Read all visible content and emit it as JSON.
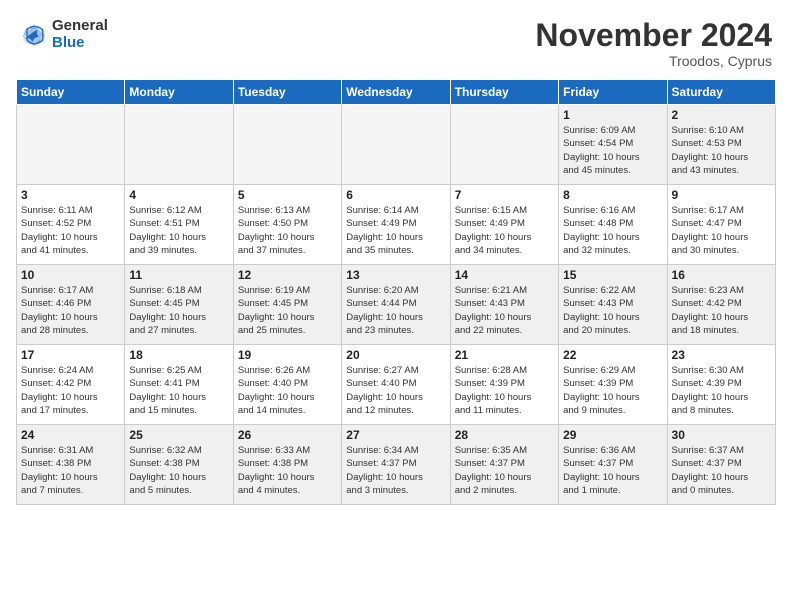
{
  "header": {
    "logo_general": "General",
    "logo_blue": "Blue",
    "month": "November 2024",
    "location": "Troodos, Cyprus"
  },
  "weekdays": [
    "Sunday",
    "Monday",
    "Tuesday",
    "Wednesday",
    "Thursday",
    "Friday",
    "Saturday"
  ],
  "weeks": [
    [
      {
        "day": "",
        "info": ""
      },
      {
        "day": "",
        "info": ""
      },
      {
        "day": "",
        "info": ""
      },
      {
        "day": "",
        "info": ""
      },
      {
        "day": "",
        "info": ""
      },
      {
        "day": "1",
        "info": "Sunrise: 6:09 AM\nSunset: 4:54 PM\nDaylight: 10 hours\nand 45 minutes."
      },
      {
        "day": "2",
        "info": "Sunrise: 6:10 AM\nSunset: 4:53 PM\nDaylight: 10 hours\nand 43 minutes."
      }
    ],
    [
      {
        "day": "3",
        "info": "Sunrise: 6:11 AM\nSunset: 4:52 PM\nDaylight: 10 hours\nand 41 minutes."
      },
      {
        "day": "4",
        "info": "Sunrise: 6:12 AM\nSunset: 4:51 PM\nDaylight: 10 hours\nand 39 minutes."
      },
      {
        "day": "5",
        "info": "Sunrise: 6:13 AM\nSunset: 4:50 PM\nDaylight: 10 hours\nand 37 minutes."
      },
      {
        "day": "6",
        "info": "Sunrise: 6:14 AM\nSunset: 4:49 PM\nDaylight: 10 hours\nand 35 minutes."
      },
      {
        "day": "7",
        "info": "Sunrise: 6:15 AM\nSunset: 4:49 PM\nDaylight: 10 hours\nand 34 minutes."
      },
      {
        "day": "8",
        "info": "Sunrise: 6:16 AM\nSunset: 4:48 PM\nDaylight: 10 hours\nand 32 minutes."
      },
      {
        "day": "9",
        "info": "Sunrise: 6:17 AM\nSunset: 4:47 PM\nDaylight: 10 hours\nand 30 minutes."
      }
    ],
    [
      {
        "day": "10",
        "info": "Sunrise: 6:17 AM\nSunset: 4:46 PM\nDaylight: 10 hours\nand 28 minutes."
      },
      {
        "day": "11",
        "info": "Sunrise: 6:18 AM\nSunset: 4:45 PM\nDaylight: 10 hours\nand 27 minutes."
      },
      {
        "day": "12",
        "info": "Sunrise: 6:19 AM\nSunset: 4:45 PM\nDaylight: 10 hours\nand 25 minutes."
      },
      {
        "day": "13",
        "info": "Sunrise: 6:20 AM\nSunset: 4:44 PM\nDaylight: 10 hours\nand 23 minutes."
      },
      {
        "day": "14",
        "info": "Sunrise: 6:21 AM\nSunset: 4:43 PM\nDaylight: 10 hours\nand 22 minutes."
      },
      {
        "day": "15",
        "info": "Sunrise: 6:22 AM\nSunset: 4:43 PM\nDaylight: 10 hours\nand 20 minutes."
      },
      {
        "day": "16",
        "info": "Sunrise: 6:23 AM\nSunset: 4:42 PM\nDaylight: 10 hours\nand 18 minutes."
      }
    ],
    [
      {
        "day": "17",
        "info": "Sunrise: 6:24 AM\nSunset: 4:42 PM\nDaylight: 10 hours\nand 17 minutes."
      },
      {
        "day": "18",
        "info": "Sunrise: 6:25 AM\nSunset: 4:41 PM\nDaylight: 10 hours\nand 15 minutes."
      },
      {
        "day": "19",
        "info": "Sunrise: 6:26 AM\nSunset: 4:40 PM\nDaylight: 10 hours\nand 14 minutes."
      },
      {
        "day": "20",
        "info": "Sunrise: 6:27 AM\nSunset: 4:40 PM\nDaylight: 10 hours\nand 12 minutes."
      },
      {
        "day": "21",
        "info": "Sunrise: 6:28 AM\nSunset: 4:39 PM\nDaylight: 10 hours\nand 11 minutes."
      },
      {
        "day": "22",
        "info": "Sunrise: 6:29 AM\nSunset: 4:39 PM\nDaylight: 10 hours\nand 9 minutes."
      },
      {
        "day": "23",
        "info": "Sunrise: 6:30 AM\nSunset: 4:39 PM\nDaylight: 10 hours\nand 8 minutes."
      }
    ],
    [
      {
        "day": "24",
        "info": "Sunrise: 6:31 AM\nSunset: 4:38 PM\nDaylight: 10 hours\nand 7 minutes."
      },
      {
        "day": "25",
        "info": "Sunrise: 6:32 AM\nSunset: 4:38 PM\nDaylight: 10 hours\nand 5 minutes."
      },
      {
        "day": "26",
        "info": "Sunrise: 6:33 AM\nSunset: 4:38 PM\nDaylight: 10 hours\nand 4 minutes."
      },
      {
        "day": "27",
        "info": "Sunrise: 6:34 AM\nSunset: 4:37 PM\nDaylight: 10 hours\nand 3 minutes."
      },
      {
        "day": "28",
        "info": "Sunrise: 6:35 AM\nSunset: 4:37 PM\nDaylight: 10 hours\nand 2 minutes."
      },
      {
        "day": "29",
        "info": "Sunrise: 6:36 AM\nSunset: 4:37 PM\nDaylight: 10 hours\nand 1 minute."
      },
      {
        "day": "30",
        "info": "Sunrise: 6:37 AM\nSunset: 4:37 PM\nDaylight: 10 hours\nand 0 minutes."
      }
    ]
  ]
}
